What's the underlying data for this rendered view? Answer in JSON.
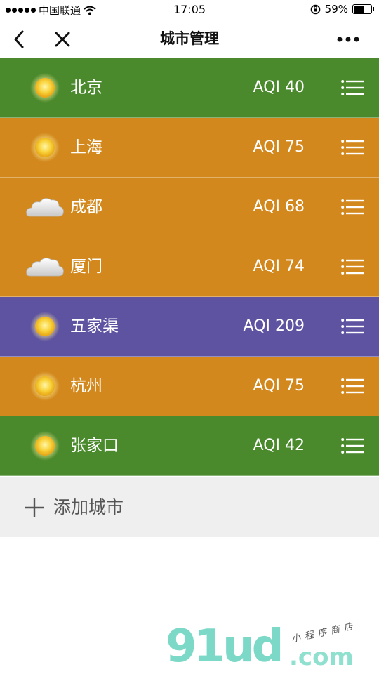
{
  "status_bar": {
    "carrier": "中国联通",
    "time": "17:05",
    "battery": "59%"
  },
  "nav": {
    "title": "城市管理",
    "back_icon": "back-arrow-icon",
    "close_icon": "close-icon",
    "more_icon": "more-dots-icon"
  },
  "cities": [
    {
      "name": "北京",
      "aqi": "AQI 40",
      "weather": "sunny",
      "color": "#4a8a2d"
    },
    {
      "name": "上海",
      "aqi": "AQI 75",
      "weather": "sunny",
      "color": "#d2881c"
    },
    {
      "name": "成都",
      "aqi": "AQI 68",
      "weather": "cloudy",
      "color": "#d2881c"
    },
    {
      "name": "厦门",
      "aqi": "AQI 74",
      "weather": "cloudy",
      "color": "#d2881c"
    },
    {
      "name": "五家渠",
      "aqi": "AQI 209",
      "weather": "sunny",
      "color": "#5e53a1"
    },
    {
      "name": "杭州",
      "aqi": "AQI 75",
      "weather": "sunny",
      "color": "#d2881c"
    },
    {
      "name": "张家口",
      "aqi": "AQI 42",
      "weather": "sunny",
      "color": "#4a8a2d"
    }
  ],
  "add_city": {
    "label": "添加城市",
    "icon": "plus-icon"
  },
  "watermark": {
    "logo": "91ud",
    "domain": ".com",
    "tagline": "小程序商店"
  }
}
